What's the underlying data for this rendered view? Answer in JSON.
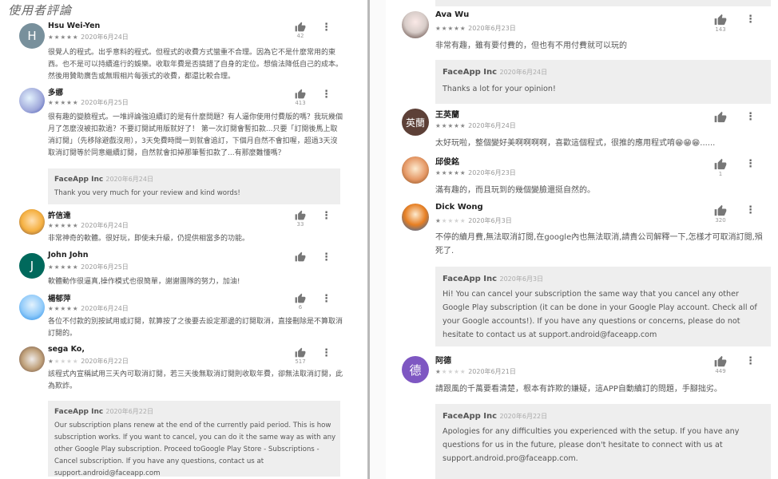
{
  "left": {
    "title": "使用者評論",
    "reviews": [
      {
        "name": "Hsu Wei-Yen",
        "avatar": "H",
        "avatar_color": "#78909c",
        "rating": 5,
        "date": "2020年6月24日",
        "likes": "42",
        "body": "很覺人的程式。出乎意料的程式。但程式的收費方式蠻重不合理。因為它不是什麼常用的東西。也不是可以持續進行的娛樂。收取年費是否搞錯了自身的定位。想偷法降低自己的成本。然後用贊助廣告或無瑕相片每張式的收費，都還比較合理。"
      },
      {
        "name": "多娜",
        "avatar": "",
        "avatar_color": "#9fa8da",
        "rating": 5,
        "date": "2020年6月25日",
        "likes": "413",
        "body": "很有趣的變臉程式。一堆評論強迫續訂的是有什麼問題？有人逼你使用付費版的嗎？我玩幾個月了怎麼沒被扣款過？不要訂閱試用版就好了！ 第一次訂閱會暫扣款...只要「訂閱後馬上取消訂閱」（先移除避戲沒用），3天免費時間一到就會追訂，下個月自然不會扣喔，超過3天沒取消訂閱等於同意繼續訂閱，自然就會扣掉那筆暫扣款了...有那麼難懂嗎？",
        "reply": {
          "name": "FaceApp Inc",
          "date": "2020年6月24日",
          "body": "Thank you very much for your review and kind words!"
        }
      },
      {
        "name": "許信達",
        "avatar": "",
        "avatar_color": "#f5b041",
        "rating": 5,
        "date": "2020年6月24日",
        "likes": "33",
        "body": "非常神奇的軟體。很好玩，即使未升級，仍提供相當多的功能。"
      },
      {
        "name": "John John",
        "avatar": "J",
        "avatar_color": "#00695c",
        "rating": 5,
        "date": "2020年6月25日",
        "likes": "",
        "body": "軟體動作很逼真,操作模式也很簡單，謝謝團隊的努力，加油!"
      },
      {
        "name": "楊郁萍",
        "avatar": "",
        "avatar_color": "#90caf9",
        "rating": 5,
        "date": "2020年6月24日",
        "likes": "6",
        "body": "各位不付款的別按試用或訂閱，就算按了之後要去設定那邊的訂閱取消，直接刪除是不算取消訂閱的。"
      },
      {
        "name": "sega Ko,",
        "avatar": "",
        "avatar_color": "#bfa07a",
        "rating": 1,
        "date": "2020年6月22日",
        "likes": "517",
        "body": "該程式內宣稱試用三天內可取消訂閱，若三天後無取消訂閱則收取年費，卻無法取消訂閱，此為欺詐。",
        "reply": {
          "name": "FaceApp Inc",
          "date": "2020年6月22日",
          "body": "Our subscription plans renew at the end of the currently paid period. This is how subscription works. If you want to cancel, you can do it the same way as with any other Google Play subscription. Proceed toGoogle Play Store - Subscriptions - Cancel subscription. If you have any questions, contact us at support.android@faceapp.com"
        }
      }
    ]
  },
  "right": {
    "reviews": [
      {
        "name": "Ava Wu",
        "avatar": "",
        "avatar_color": "#d7ccc8",
        "rating": 5,
        "date": "2020年6月23日",
        "likes": "143",
        "body": "非常有趣，雖有要付費的，但也有不用付費就可以玩的",
        "reply": {
          "name": "FaceApp Inc",
          "date": "2020年6月24日",
          "body": "Thanks a lot for your opinion!"
        }
      },
      {
        "name": "王英蘭",
        "avatar": "英蘭",
        "avatar_color": "#5d4037",
        "rating": 5,
        "date": "2020年6月24日",
        "likes": "",
        "body": "太好玩啦，整個變好美啊啊啊啊，喜歡這個程式，很推的應用程式唷😁😁😁......"
      },
      {
        "name": "邱俊銘",
        "avatar": "",
        "avatar_color": "#e59866",
        "rating": 5,
        "date": "2020年6月23日",
        "likes": "1",
        "body": "滿有趣的，而且玩到的幾個變臉還挺自然的。"
      },
      {
        "name": "Dick Wong",
        "avatar": "",
        "avatar_color": "#e67e22",
        "rating": 1,
        "date": "2020年6月3日",
        "likes": "320",
        "body": "不停的續月費,無法取消訂閱,在google內也無法取消,請貴公司解釋一下,怎樣才可取消訂閱,殞死了.",
        "reply": {
          "name": "FaceApp Inc",
          "date": "2020年6月3日",
          "body": "Hi! You can cancel your subscription the same way that you cancel any other Google Play subscription (it can be done in your Google Play account. Check all of your Google accounts!). If you have any questions or concerns, please do not hesitate to contact us at support.android@faceapp.com"
        }
      },
      {
        "name": "阿德",
        "avatar": "德",
        "avatar_color": "#7e57c2",
        "rating": 1,
        "date": "2020年6月21日",
        "likes": "449",
        "body": "請跟風的千萬要看清楚，根本有詐欺的嫌疑，這APP自動續訂的問題，手腳拙劣。",
        "reply": {
          "name": "FaceApp Inc",
          "date": "2020年6月22日",
          "body": "Apologies for any difficulties you experienced with the setup. If you have any questions for us in the future, please don't hesitate to connect with us at support.android.pro@faceapp.com."
        }
      }
    ]
  }
}
